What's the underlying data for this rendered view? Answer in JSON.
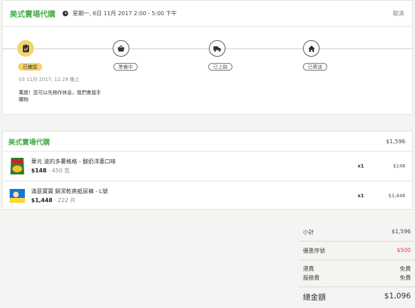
{
  "header": {
    "store_name": "美式賣場代購",
    "schedule": "星期一, 6日 11月 2017   2:00 - 5:00 下午",
    "cancel_label": "取消"
  },
  "tracker": {
    "steps": [
      {
        "label": "已確認",
        "icon": "clipboard-check-icon",
        "active": true
      },
      {
        "label": "準備中",
        "icon": "basket-icon",
        "active": false
      },
      {
        "label": "已上路",
        "icon": "truck-icon",
        "active": false
      },
      {
        "label": "已寄送",
        "icon": "home-icon",
        "active": false
      }
    ],
    "confirmed_time": "03 11月 2017, 11:29 晚上",
    "note": "萬歲！您可以先稍作休息，我們會接手購物"
  },
  "order": {
    "store_name": "美式賣場代購",
    "total": "$1,596",
    "items": [
      {
        "name": "華元 波的多薯格格 - 酸奶洋蔥口味",
        "price": "$148",
        "size": " · 450 克",
        "qty": "x1",
        "subtotal": "$148"
      },
      {
        "name": "滿意寶寶 銅潔乾爽紙尿褲 - L號",
        "price": "$1,448",
        "size": " · 222 片",
        "qty": "x1",
        "subtotal": "$1,448"
      }
    ]
  },
  "summary": {
    "subtotal_label": "小計",
    "subtotal": "$1,596",
    "promo_label": "優惠序號",
    "promo": "$500",
    "shipping_label": "運費",
    "shipping": "免費",
    "service_label": "服務費",
    "service": "免費",
    "total_label": "總金額",
    "total": "$1,096"
  },
  "colors": {
    "accent_green": "#4caf50",
    "active_yellow": "#f5d36b",
    "discount_red": "#e53935"
  }
}
